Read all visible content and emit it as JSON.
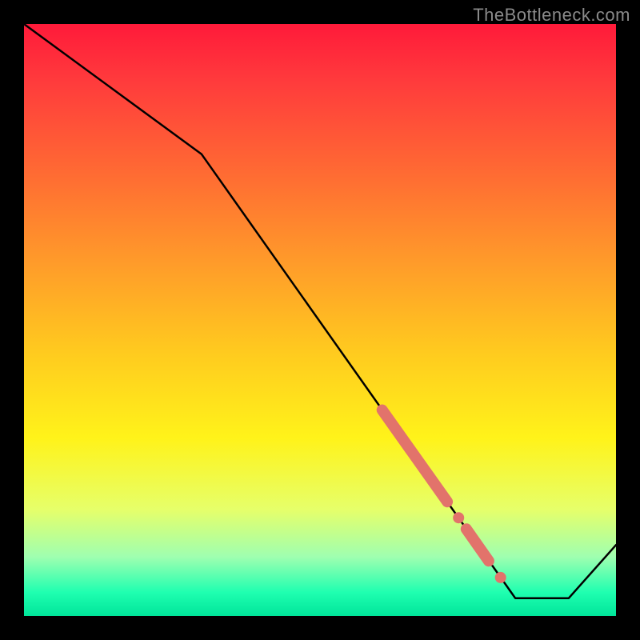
{
  "watermark": "TheBottleneck.com",
  "chart_data": {
    "type": "line",
    "title": "",
    "xlabel": "",
    "ylabel": "",
    "xlim": [
      0,
      100
    ],
    "ylim": [
      0,
      100
    ],
    "grid": false,
    "legend": false,
    "series": [
      {
        "name": "main-curve",
        "color": "#000000",
        "x": [
          0,
          30,
          83,
          92,
          100
        ],
        "y": [
          100,
          78,
          3,
          3,
          12
        ]
      },
      {
        "name": "highlight-segment-1",
        "color": "#e2736b",
        "thick": true,
        "x": [
          60.5,
          71.5
        ],
        "y": [
          34.8,
          19.3
        ]
      },
      {
        "name": "highlight-dot-1",
        "color": "#e2736b",
        "dot": true,
        "x": [
          73.4
        ],
        "y": [
          16.6
        ]
      },
      {
        "name": "highlight-segment-2",
        "color": "#e2736b",
        "thick": true,
        "x": [
          74.7,
          78.5
        ],
        "y": [
          14.7,
          9.3
        ]
      },
      {
        "name": "highlight-dot-2",
        "color": "#e2736b",
        "dot": true,
        "x": [
          80.5
        ],
        "y": [
          6.5
        ]
      }
    ]
  }
}
